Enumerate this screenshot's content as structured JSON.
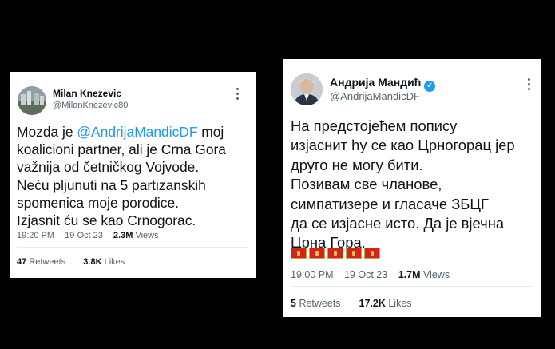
{
  "tweets": [
    {
      "display_name": "Milan Knezevic",
      "handle": "@MilanKnezevic80",
      "text_before_mention": "Mozda je ",
      "mention": "@AndrijaMandicDF",
      "text_after_mention": " moj\nkoalicioni partner, ali je Crna Gora\nvažnija od četničkog Vojvode.\nNeću pljunuti na 5 partizanskih\nspomenica moje porodice.\nIzjasnit ću se kao Crnogorac.",
      "time": "19:20 PM",
      "date": "19 Oct 23",
      "views_count": "2.3M",
      "views_label": "Views",
      "retweets_count": "47",
      "retweets_label": "Retweets",
      "likes_count": "3.8K",
      "likes_label": "Likes"
    },
    {
      "display_name": "Андрија Мандић",
      "verified": true,
      "handle": "@AndrijaMandicDF",
      "text": "На предстојећем попису\nизјаснит ћу се као Црногорац јер\nдруго не могу бити.\nПозивам све чланове,\nсимпатизере и гласаче ЗБЦГ\nда се изјасне исто. Да је вјечна\nЦрна Гора.",
      "flag_emoji_count": 5,
      "time": "19:00 PM",
      "date": "19 Oct 23",
      "views_count": "1.7M",
      "views_label": "Views",
      "retweets_count": "5",
      "retweets_label": "Retweets",
      "likes_count": "17.2K",
      "likes_label": "Likes"
    }
  ],
  "colors": {
    "background": "#000000",
    "link": "#1d9bf0",
    "secondary_text": "#536471",
    "flag_red": "#d3241c",
    "flag_gold": "#e7c24a"
  },
  "icons": [
    "user-avatar",
    "verified-badge-icon",
    "more-options-icon",
    "montenegro-flag-icon"
  ]
}
